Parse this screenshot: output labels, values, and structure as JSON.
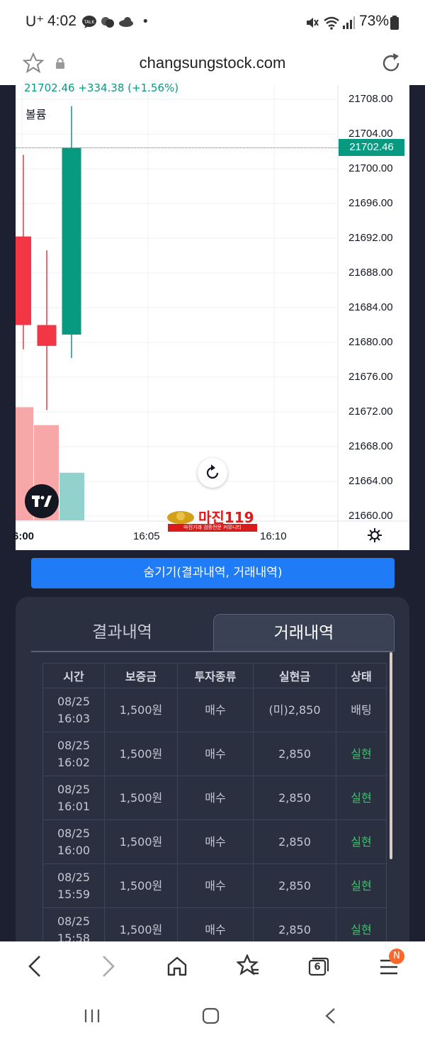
{
  "status_bar": {
    "carrier": "U⁺",
    "time": "4:02",
    "battery": "73%",
    "icons": [
      "talk-icon",
      "chat-icon",
      "cloud-icon",
      "mute-icon",
      "wifi-icon",
      "signal-icon",
      "battery-icon"
    ]
  },
  "browser": {
    "url": "changsungstock.com",
    "icons": [
      "star-icon",
      "lock-icon",
      "reload-icon"
    ]
  },
  "chart_data": {
    "type": "candlestick",
    "header_text": "21702.46 +334.38 (+1.56%)",
    "volume_label": "볼륨",
    "last_price": "21702.46",
    "y_ticks": [
      "21708.00",
      "21704.00",
      "21700.00",
      "21696.00",
      "21692.00",
      "21688.00",
      "21684.00",
      "21680.00",
      "21676.00",
      "21672.00",
      "21668.00",
      "21664.00",
      "21660.00"
    ],
    "ylim": [
      21660,
      21708
    ],
    "x_ticks": [
      "6:00",
      "16:05",
      "16:10"
    ],
    "candles": [
      {
        "open": 21692.2,
        "high": 21701.6,
        "low": 21679.2,
        "close": 21682.0,
        "direction": "down"
      },
      {
        "open": 21682.0,
        "high": 21690.6,
        "low": 21672.2,
        "close": 21679.6,
        "direction": "down"
      },
      {
        "open": 21680.9,
        "high": 21707.2,
        "low": 21678.2,
        "close": 21702.4,
        "direction": "up"
      }
    ],
    "volumes": [
      0.95,
      0.8,
      0.4
    ],
    "colors": {
      "up": "#089981",
      "down": "#f23645",
      "up_vol": "#92d2cc",
      "down_vol": "#f7a7a7"
    },
    "logo_text": "TV",
    "watermark_text": "마진119",
    "watermark_sub": "마진거래 검증전문 커뮤니티"
  },
  "hide_button": {
    "label": "숨기기(결과내역, 거래내역)"
  },
  "tabs": {
    "results": "결과내역",
    "trades": "거래내역",
    "active": "trades"
  },
  "table": {
    "headers": [
      "시간",
      "보증금",
      "투자종류",
      "실현금",
      "상태"
    ],
    "rows": [
      {
        "date": "08/25",
        "time": "16:03",
        "deposit": "1,500원",
        "type": "매수",
        "amount": "(미)2,850",
        "status": "배팅"
      },
      {
        "date": "08/25",
        "time": "16:02",
        "deposit": "1,500원",
        "type": "매수",
        "amount": "2,850",
        "status": "실현"
      },
      {
        "date": "08/25",
        "time": "16:01",
        "deposit": "1,500원",
        "type": "매수",
        "amount": "2,850",
        "status": "실현"
      },
      {
        "date": "08/25",
        "time": "16:00",
        "deposit": "1,500원",
        "type": "매수",
        "amount": "2,850",
        "status": "실현"
      },
      {
        "date": "08/25",
        "time": "15:59",
        "deposit": "1,500원",
        "type": "매수",
        "amount": "2,850",
        "status": "실현"
      },
      {
        "date": "08/25",
        "time": "15:58",
        "deposit": "1,500원",
        "type": "매수",
        "amount": "2,850",
        "status": "실현"
      }
    ]
  },
  "bottom_nav": {
    "tab_count": "6",
    "badge": "N",
    "icons": [
      "back-icon",
      "forward-icon",
      "home-icon",
      "bookmarks-icon",
      "tabs-icon",
      "menu-icon",
      "recent-apps-icon",
      "home-button-icon",
      "system-back-icon"
    ]
  }
}
